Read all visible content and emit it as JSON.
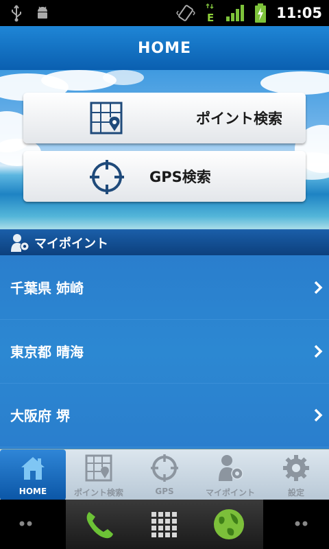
{
  "status_bar": {
    "time": "11:05",
    "icons": [
      "usb-icon",
      "android-debug-icon",
      "vibrate-icon",
      "edge-data-icon",
      "signal-icon",
      "battery-charging-icon"
    ],
    "network_type": "E"
  },
  "header": {
    "title": "HOME"
  },
  "buttons": {
    "point_search_label": "ポイント検索",
    "gps_search_label": "GPS検索"
  },
  "my_points": {
    "title": "マイポイント",
    "items": [
      {
        "label": "千葉県 姉崎"
      },
      {
        "label": "東京都 晴海"
      },
      {
        "label": "大阪府 堺"
      }
    ]
  },
  "tabs": [
    {
      "label": "HOME",
      "icon": "home-icon",
      "active": true
    },
    {
      "label": "ポイント検索",
      "icon": "map-grid-icon",
      "active": false
    },
    {
      "label": "GPS",
      "icon": "crosshair-icon",
      "active": false
    },
    {
      "label": "マイポイント",
      "icon": "person-pin-icon",
      "active": false
    },
    {
      "label": "設定",
      "icon": "gear-icon",
      "active": false
    }
  ],
  "colors": {
    "header_blue": "#0a5fb0",
    "list_blue": "#2a7ecd",
    "icon_navy": "#1f4a7a"
  }
}
